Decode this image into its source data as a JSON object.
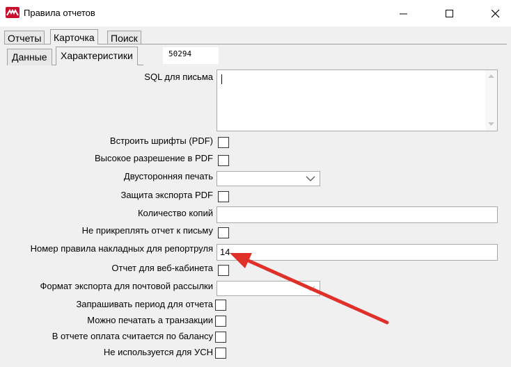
{
  "window": {
    "title": "Правила отчетов"
  },
  "tabs": [
    {
      "label": "Отчеты"
    },
    {
      "label": "Карточка"
    },
    {
      "label": "Поиск"
    }
  ],
  "subtabs": [
    {
      "label": "Данные"
    },
    {
      "label": "Характеристики"
    }
  ],
  "record_id": "50294",
  "fields": {
    "sql": {
      "label": "SQL для письма",
      "value": ""
    },
    "embed_fonts": {
      "label": "Встроить шрифты (PDF)",
      "checked": false
    },
    "high_res": {
      "label": "Высокое разрешение в PDF",
      "checked": false
    },
    "duplex": {
      "label": "Двусторонняя печать",
      "value": ""
    },
    "protect_pdf": {
      "label": "Защита экспорта PDF",
      "checked": false
    },
    "copies": {
      "label": "Количество копий",
      "value": ""
    },
    "no_attach": {
      "label": "Не прикреплять отчет к письму",
      "checked": false
    },
    "invoice_rule": {
      "label": "Номер правила накладных для репортруля",
      "value": "14"
    },
    "web_cabinet": {
      "label": "Отчет для веб-кабинета",
      "checked": false
    },
    "mail_format": {
      "label": "Формат экспорта для почтовой рассылки",
      "value": ""
    },
    "ask_period": {
      "label": "Запрашивать период для отчета",
      "checked": false
    },
    "print_in_tx": {
      "label": "Можно печатать а транзакции",
      "checked": false
    },
    "balance_pay": {
      "label": "В отчете оплата считается по балансу",
      "checked": false
    },
    "no_usn": {
      "label": "Не используется для УСН",
      "checked": false
    }
  },
  "colors": {
    "annotation_arrow": "#e0302a",
    "logo": "#c8102e",
    "panel": "#f0f0f0"
  }
}
